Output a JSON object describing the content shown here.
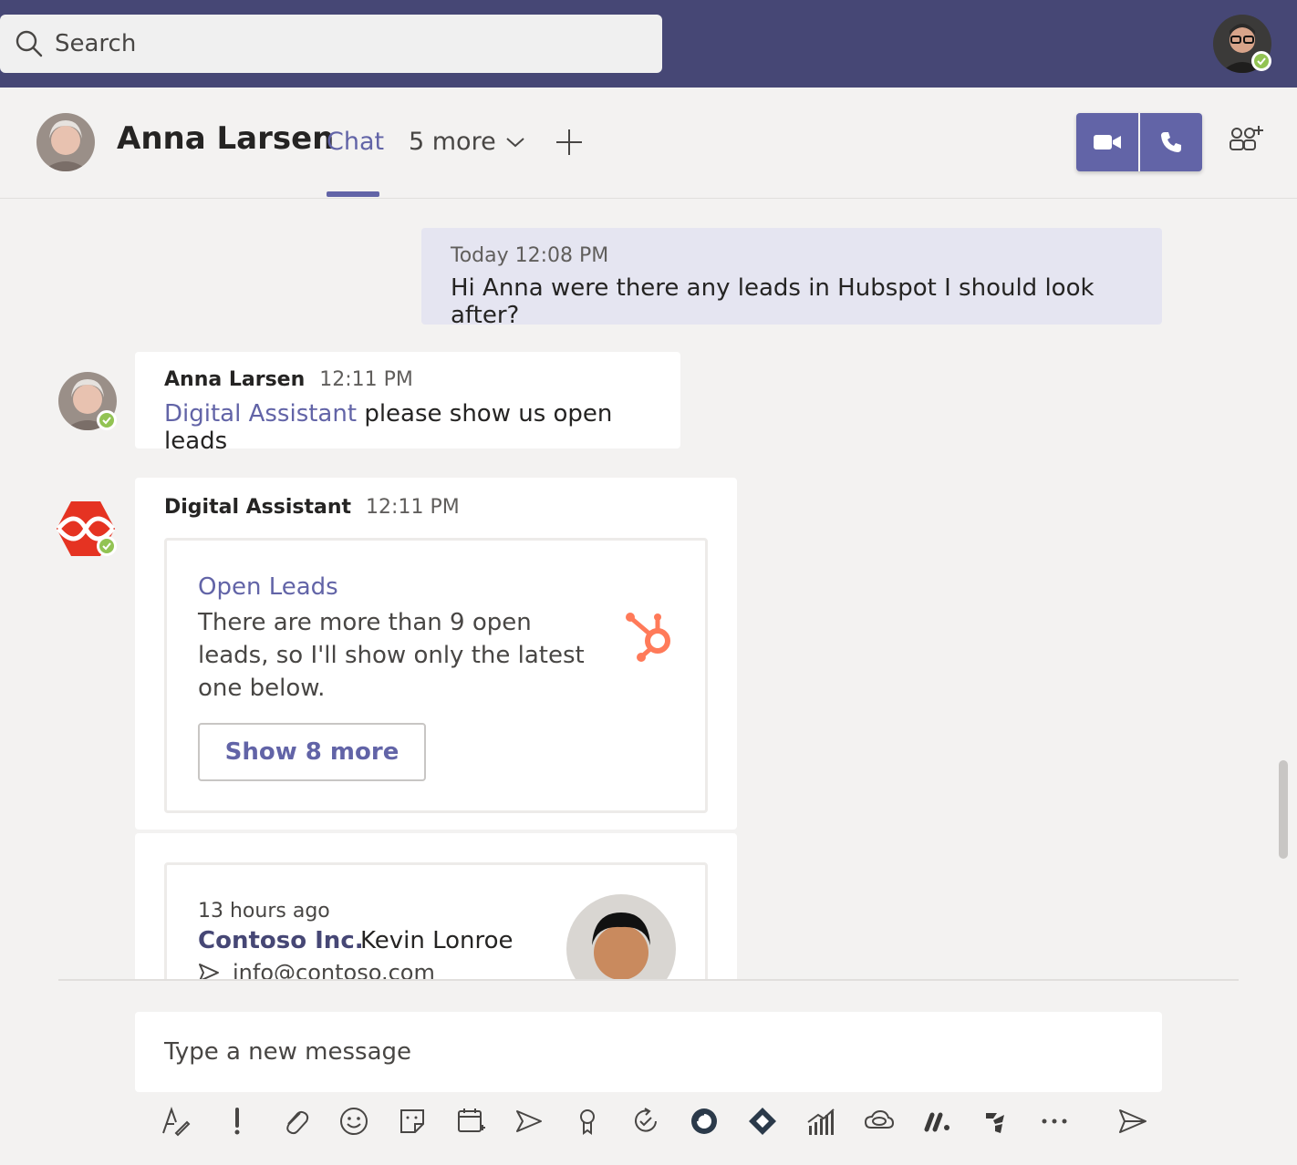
{
  "search": {
    "placeholder": "Search"
  },
  "header": {
    "contact_name": "Anna Larsen",
    "tab_chat": "Chat",
    "tab_more": "5 more"
  },
  "messages": [
    {
      "id": "mine",
      "time": "Today 12:08 PM",
      "text": "Hi Anna were there any leads in Hubspot I should look after?"
    },
    {
      "id": "anna",
      "sender": "Anna Larsen",
      "time": "12:11 PM",
      "mention": "Digital Assistant",
      "text": "please show us open leads"
    },
    {
      "id": "bot",
      "sender": "Digital Assistant",
      "time": "12:11 PM",
      "card": {
        "title": "Open Leads",
        "description": "There are more than 9 open leads, so I'll show only the latest one below.",
        "button": "Show 8 more"
      }
    }
  ],
  "lead_card": {
    "ago": "13 hours ago",
    "company": "Contoso Inc.",
    "contact": "Kevin Lonroe",
    "email": "info@contoso.com"
  },
  "compose": {
    "placeholder": "Type a new message"
  },
  "toolbar": [
    "format-icon",
    "important-icon",
    "attach-icon",
    "emoji-icon",
    "sticker-icon",
    "schedule-meeting-icon",
    "stream-icon",
    "praise-icon",
    "approvals-icon",
    "loop-icon",
    "jira-icon",
    "analytics-icon",
    "creative-cloud-icon",
    "monday-icon",
    "jira-cloud-icon",
    "more-icon"
  ],
  "colors": {
    "brand": "#6264a7",
    "topbar": "#464775",
    "presence": "#92c353",
    "hubspot": "#ff7a59"
  }
}
